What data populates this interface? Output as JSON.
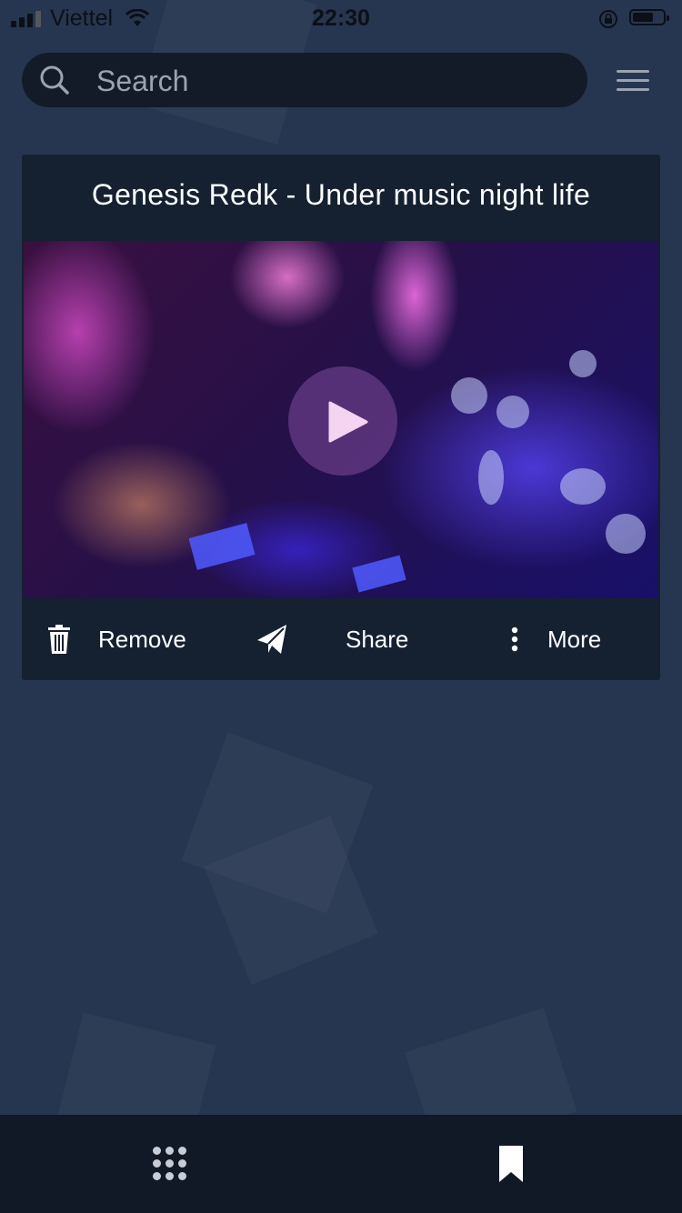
{
  "status_bar": {
    "carrier": "Viettel",
    "time": "22:30",
    "battery_level": 0.65
  },
  "search": {
    "placeholder": "Search"
  },
  "card": {
    "title": "Genesis Redk - Under music night life",
    "actions": [
      {
        "label": "Remove",
        "icon": "trash-icon"
      },
      {
        "label": "Share",
        "icon": "paper-plane-icon"
      },
      {
        "label": "More",
        "icon": "vertical-dots-icon"
      }
    ]
  },
  "bottom_nav": {
    "items": [
      "grid-icon",
      "bookmark-icon"
    ]
  },
  "colors": {
    "background": "#263650",
    "card": "#152031",
    "search_bar": "#141b28",
    "nav": "#111826",
    "play_button": "#5c347c"
  }
}
